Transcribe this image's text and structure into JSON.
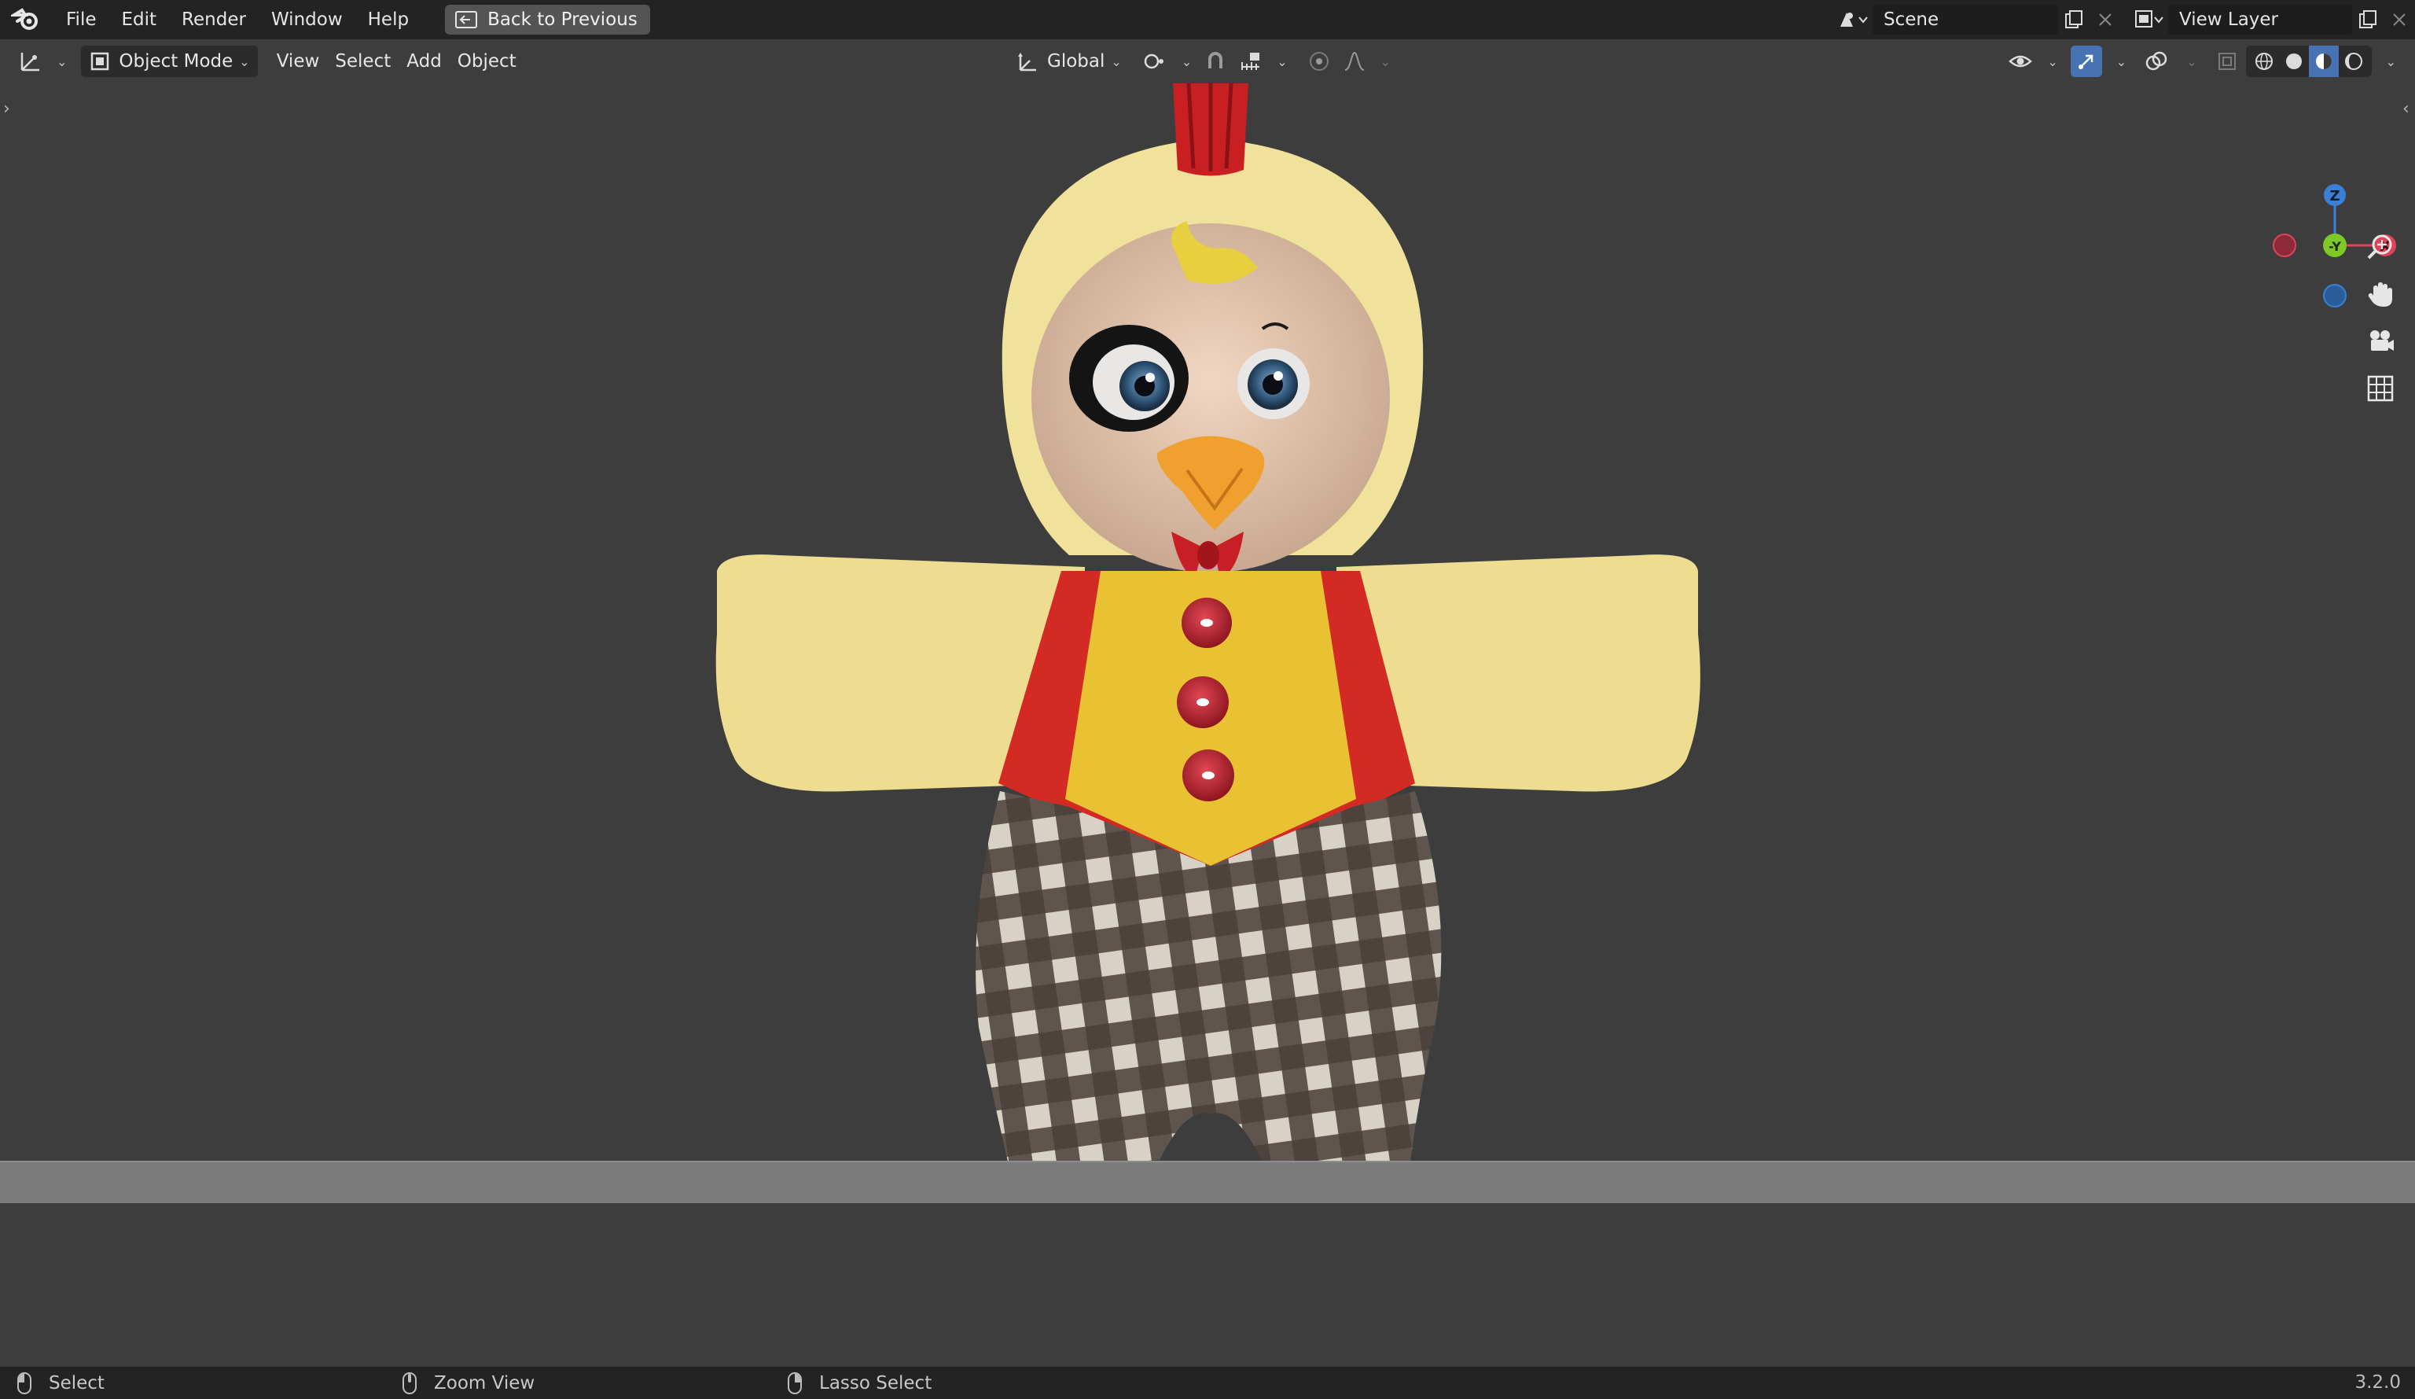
{
  "topbar": {
    "menus": [
      "File",
      "Edit",
      "Render",
      "Window",
      "Help"
    ],
    "back_button": "Back to Previous",
    "scene": "Scene",
    "view_layer": "View Layer"
  },
  "header": {
    "mode": "Object Mode",
    "menus": [
      "View",
      "Select",
      "Add",
      "Object"
    ],
    "orientation": "Global"
  },
  "gizmo": {
    "z": "Z",
    "y": "-Y",
    "x": "X"
  },
  "statusbar": {
    "left": "Select",
    "middle": "Zoom View",
    "right": "Lasso Select",
    "version": "3.2.0"
  },
  "colors": {
    "accent": "#4772b3",
    "axis_x": "#e0425a",
    "axis_y": "#7ec927",
    "axis_z": "#3b7fd6"
  }
}
